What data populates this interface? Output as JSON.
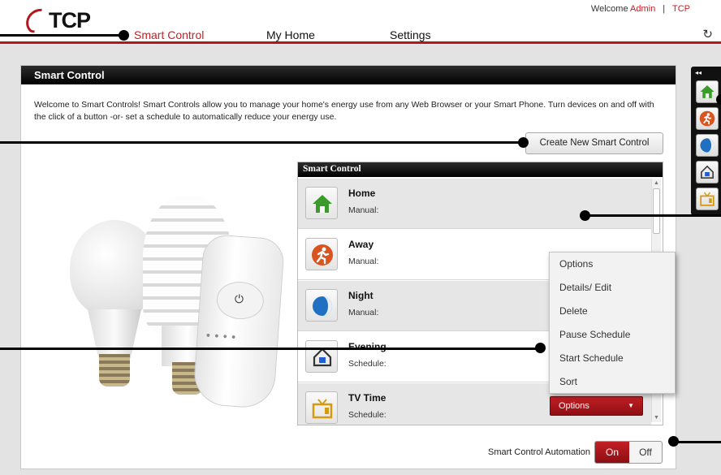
{
  "header": {
    "logo_text": "TCP",
    "welcome": "Welcome",
    "user": "Admin",
    "separator": "|",
    "brand": "TCP",
    "nav": [
      {
        "label": "Smart Control",
        "active": true
      },
      {
        "label": "My Home",
        "active": false
      },
      {
        "label": "Settings",
        "active": false
      }
    ],
    "refresh_icon": "refresh-icon"
  },
  "panel": {
    "title": "Smart Control",
    "intro": "Welcome to Smart Controls! Smart Controls allow you to manage your home's energy use from any Web Browser or your Smart Phone. Turn devices on and off with the click of a button -or- set a schedule to automatically reduce your energy use.",
    "create_button": "Create New Smart Control"
  },
  "list": {
    "title": "Smart Control",
    "items": [
      {
        "name": "Home",
        "mode": "Manual:",
        "icon": "home-icon"
      },
      {
        "name": "Away",
        "mode": "Manual:",
        "icon": "running-man-icon"
      },
      {
        "name": "Night",
        "mode": "Manual:",
        "icon": "moon-icon"
      },
      {
        "name": "Evening",
        "mode": "Schedule:",
        "icon": "house-light-icon"
      },
      {
        "name": "TV Time",
        "mode": "Schedule:",
        "icon": "tv-icon"
      }
    ],
    "options_button": "Options"
  },
  "dropdown": {
    "items": [
      "Options",
      "Details/ Edit",
      "Delete",
      "Pause Schedule",
      "Start Schedule",
      "Sort"
    ]
  },
  "automation": {
    "label": "Smart Control Automation",
    "on": "On",
    "off": "Off",
    "state": "On"
  },
  "quickbar": {
    "collapse_label": "◂◂",
    "icons": [
      "home-icon",
      "running-man-icon",
      "moon-icon",
      "house-light-icon",
      "tv-icon"
    ]
  },
  "colors": {
    "brand_red": "#c81d23",
    "header_black": "#000000",
    "shade_row": "#e6e6e6"
  }
}
